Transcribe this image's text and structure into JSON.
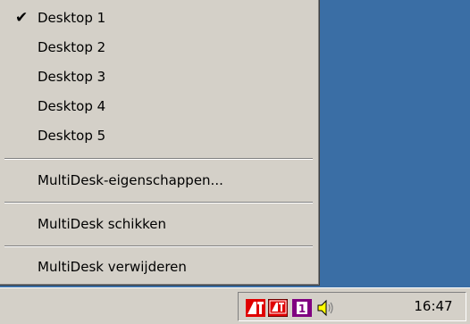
{
  "menu": {
    "desktops": [
      {
        "label": "Desktop 1",
        "checked": true
      },
      {
        "label": "Desktop 2",
        "checked": false
      },
      {
        "label": "Desktop 3",
        "checked": false
      },
      {
        "label": "Desktop 4",
        "checked": false
      },
      {
        "label": "Desktop 5",
        "checked": false
      }
    ],
    "check_glyph": "✔",
    "properties_label": "MultiDesk-eigenschappen...",
    "arrange_label": "MultiDesk schikken",
    "remove_label": "MultiDesk verwijderen"
  },
  "tray": {
    "icons": [
      "ati-icon",
      "ati-display-icon",
      "multidesk-1-icon",
      "speaker-icon"
    ],
    "multidesk_number": "1",
    "clock": "16:47"
  },
  "colors": {
    "desktop": "#3a6ea5",
    "menu_bg": "#d4d0c8",
    "ati_red": "#e00000",
    "multidesk_purple": "#800080"
  }
}
